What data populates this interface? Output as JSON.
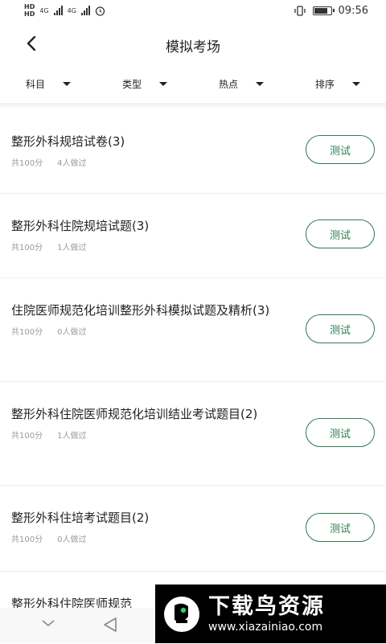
{
  "status_bar": {
    "hd_labels": [
      "HD",
      "HD"
    ],
    "sims": [
      "4G",
      "4G"
    ],
    "time": "09:56",
    "battery_level": 0.85
  },
  "header": {
    "title": "模拟考场"
  },
  "filters": [
    "科目",
    "类型",
    "热点",
    "排序"
  ],
  "items": [
    {
      "title": "整形外科规培试卷(3)",
      "score": "共100分",
      "done": "4人做过",
      "button": "测试"
    },
    {
      "title": "整形外科住院规培试题(3)",
      "score": "共100分",
      "done": "1人做过",
      "button": "测试"
    },
    {
      "title": "住院医师规范化培训整形外科模拟试题及精析(3)",
      "score": "共100分",
      "done": "0人做过",
      "button": "测试"
    },
    {
      "title": "整形外科住院医师规范化培训结业考试题目(2)",
      "score": "共100分",
      "done": "1人做过",
      "button": "测试"
    },
    {
      "title": "整形外科住培考试题目(2)",
      "score": "共100分",
      "done": "0人做过",
      "button": "测试"
    },
    {
      "title": "整形外科住院医师规范",
      "score": "",
      "done": "",
      "button": ""
    }
  ],
  "watermark": {
    "name": "下载鸟资源",
    "url": "www.xiazainiao.com"
  }
}
